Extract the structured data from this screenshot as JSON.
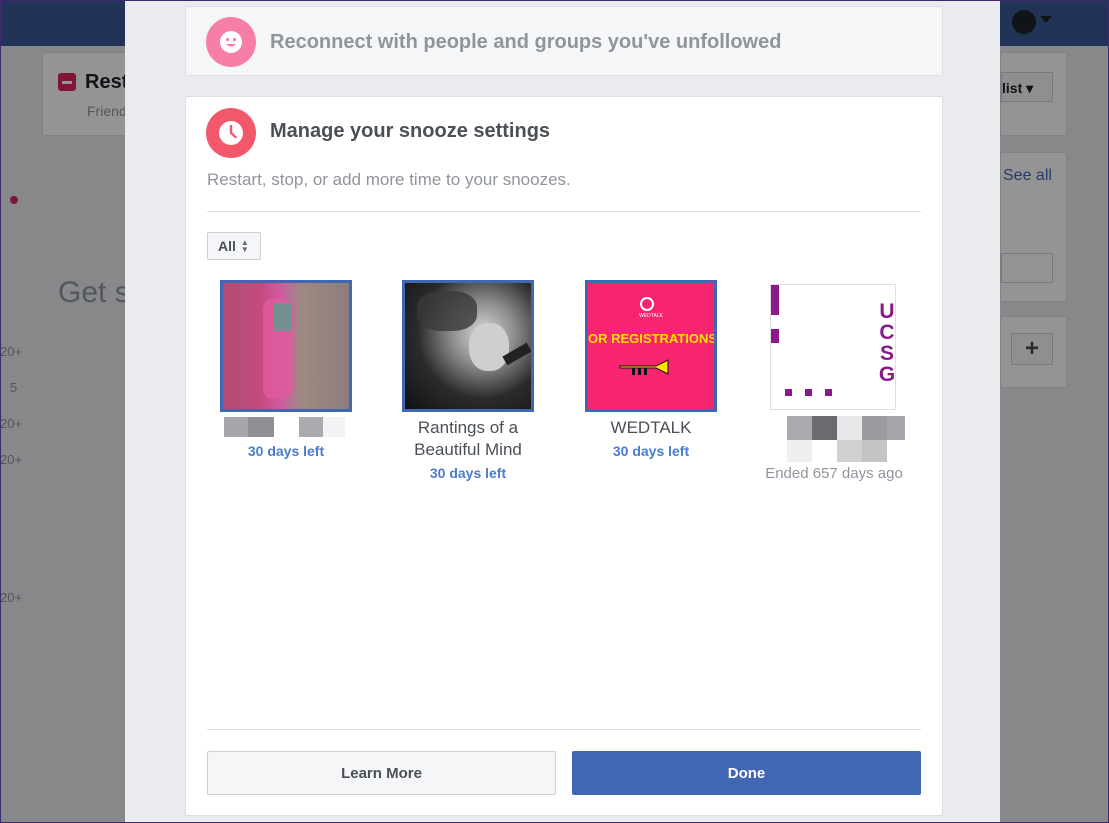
{
  "background": {
    "header_title": "Rest",
    "header_sub": "Friend",
    "list_button": "list ▾",
    "see_all": "See all",
    "get_label": "Get s",
    "side_counts": [
      "20+",
      "5",
      "20+",
      "20+",
      "20+"
    ]
  },
  "reconnect": {
    "icon": "smile-icon",
    "title": "Reconnect with people and groups you've unfollowed"
  },
  "snooze": {
    "icon": "clock-icon",
    "title": "Manage your snooze settings",
    "subtitle": "Restart, stop, or add more time to your snoozes.",
    "filter": {
      "selected": "All"
    },
    "items": [
      {
        "name": "",
        "status": "30 days left"
      },
      {
        "name": "Rantings of a Beautiful Mind",
        "status": "30 days left"
      },
      {
        "name": "WEDTALK",
        "status": "30 days left",
        "banner_text": "OR REGISTRATIONS (",
        "logo_text": "WEDTALK"
      },
      {
        "name": "",
        "status": "Ended 657 days ago",
        "image_text": "UCSG"
      }
    ]
  },
  "footer": {
    "learn_more": "Learn More",
    "done": "Done"
  },
  "colors": {
    "accent": "#4267b2",
    "link": "#4a7cc9",
    "smile_circle": "#f77fa5",
    "clock_circle": "#f3586a",
    "wedtalk_bg": "#f7246f"
  }
}
